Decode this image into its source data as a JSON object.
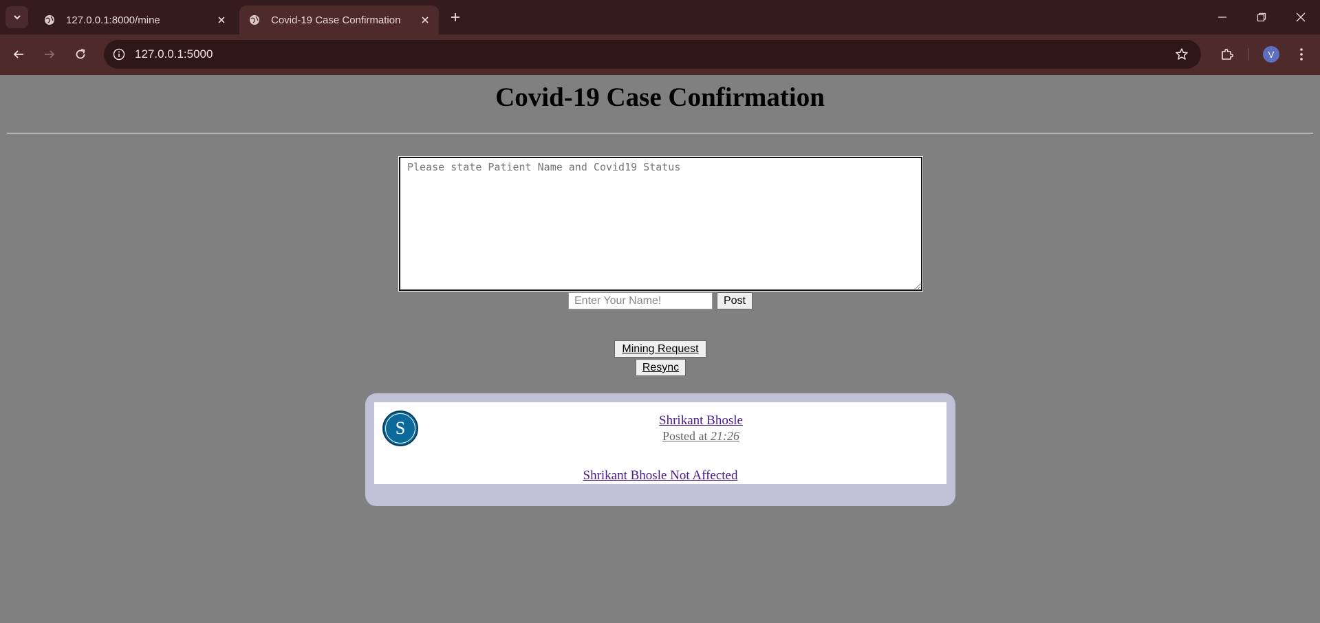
{
  "browser": {
    "tabs": [
      {
        "title": "127.0.0.1:8000/mine",
        "active": false
      },
      {
        "title": "Covid-19 Case Confirmation",
        "active": true
      }
    ],
    "url": "127.0.0.1:5000",
    "profile_initial": "V",
    "colors": {
      "tabbar": "#351b1b",
      "toolbar": "#4e2a2a",
      "omnibox": "#2f1717"
    }
  },
  "page": {
    "heading": "Covid-19 Case Confirmation",
    "form": {
      "textarea_placeholder": "Please state Patient Name and Covid19 Status",
      "textarea_value": "",
      "name_placeholder": "Enter Your Name!",
      "name_value": "",
      "post_label": "Post"
    },
    "actions": {
      "mining_label": "Mining Request",
      "resync_label": "Resync"
    },
    "posts": [
      {
        "avatar_initial": "S",
        "author": "Shrikant Bhosle",
        "posted_prefix": "Posted at",
        "time": "21:26",
        "message": "Shrikant Bhosle Not Affected"
      }
    ],
    "colors": {
      "background": "#808080",
      "card": "#c0c0d6",
      "avatar": "#0b6a9a",
      "link": "#4a1a8a"
    }
  }
}
